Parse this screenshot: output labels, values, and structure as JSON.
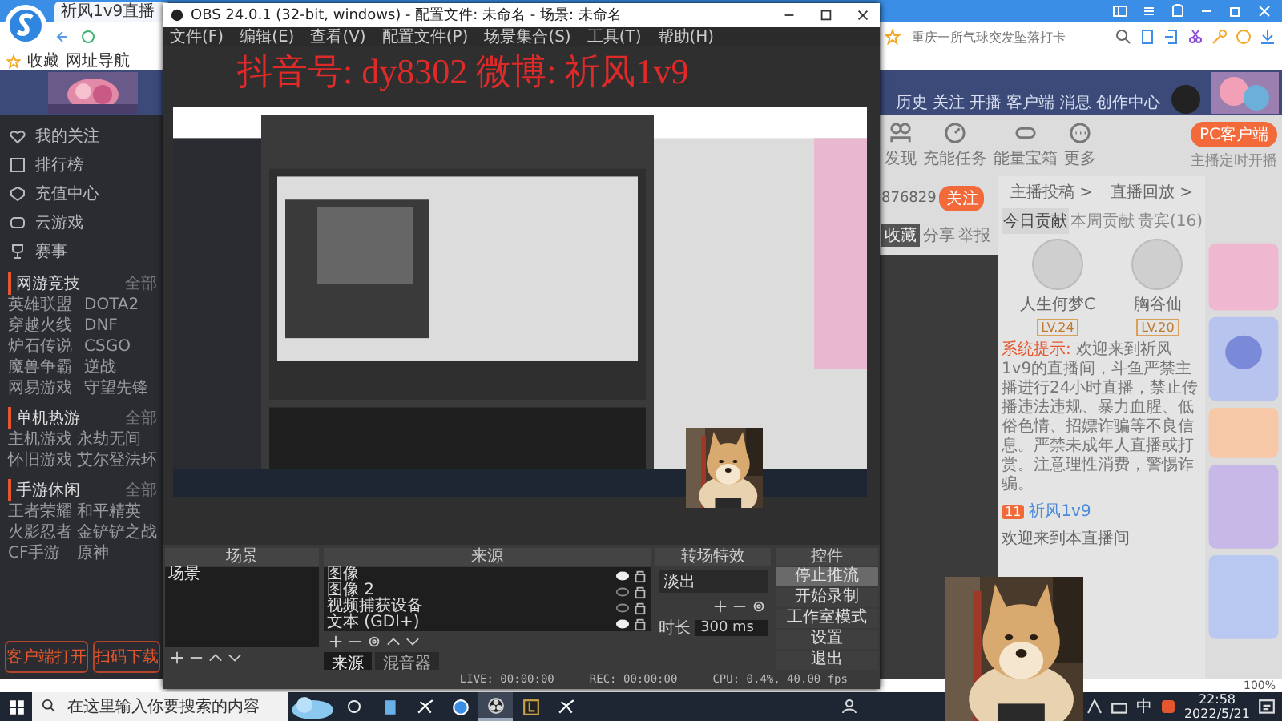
{
  "browser": {
    "tab_title": "祈风1v9直播",
    "bookmarks": [
      "收藏",
      "网址导航"
    ],
    "search": {
      "placeholder": "重庆一所气球突发坠落打卡"
    },
    "nav": [
      "历史",
      "关注",
      "开播",
      "客户端",
      "消息",
      "创作中心"
    ],
    "sidebar": {
      "items": [
        "我的关注",
        "排行榜",
        "充值中心",
        "云游戏",
        "赛事"
      ],
      "sections": [
        {
          "title": "网游竞技",
          "more": "全部",
          "links": [
            "英雄联盟",
            "DOTA2",
            "穿越火线",
            "DNF",
            "炉石传说",
            "CSGO",
            "魔兽争霸",
            "逆战",
            "网易游戏",
            "守望先锋"
          ]
        },
        {
          "title": "单机热游",
          "more": "全部",
          "links": [
            "主机游戏",
            "永劫无间",
            "怀旧游戏",
            "艾尔登法环"
          ]
        },
        {
          "title": "手游休闲",
          "more": "全部",
          "links": [
            "王者荣耀",
            "和平精英",
            "火影忍者",
            "金铲铲之战",
            "CF手游",
            "原神"
          ]
        }
      ],
      "buttons": [
        "客户端打开",
        "扫码下载"
      ]
    },
    "room": {
      "actions": [
        "发现",
        "充能任务",
        "能量宝箱",
        "更多"
      ],
      "client_button": "PC客户端",
      "client_note": "主播定时开播",
      "followers": "876829",
      "follow_button": "关注",
      "tools": [
        "收藏",
        "分享",
        "举报"
      ],
      "links": [
        "主播投稿 >",
        "直播回放 >"
      ],
      "rank_tabs": [
        {
          "label": "今日贡献",
          "selected": true
        },
        {
          "label": "本周贡献",
          "selected": false
        },
        {
          "label": "贵宾(16)",
          "selected": false
        }
      ],
      "users": [
        {
          "name": "人生何梦C",
          "level": "LV.24"
        },
        {
          "name": "胸谷仙",
          "level": "LV.20"
        }
      ],
      "system_label": "系统提示:",
      "system_message": "欢迎来到祈风1v9的直播间，斗鱼严禁主播进行24小时直播，禁止传播违法违规、暴力血腥、低俗色情、招嫖诈骗等不良信息。严禁未成年人直播或打赏。注意理性消费，警惕诈骗。",
      "chat": {
        "badge": "11",
        "user": "祈风1v9",
        "text": "欢迎来到本直播间"
      },
      "zoom": "100%"
    }
  },
  "overlay_text": "抖音号: dy8302  微博: 祈风1v9",
  "obs": {
    "title": "OBS 24.0.1 (32-bit, windows) - 配置文件: 未命名 - 场景: 未命名",
    "menu": [
      "文件(F)",
      "编辑(E)",
      "查看(V)",
      "配置文件(P)",
      "场景集合(S)",
      "工具(T)",
      "帮助(H)"
    ],
    "docks": {
      "scenes": {
        "title": "场景",
        "items": [
          "场景"
        ]
      },
      "sources": {
        "title": "来源",
        "items": [
          {
            "name": "图像",
            "visible": true
          },
          {
            "name": "图像 2",
            "visible": false
          },
          {
            "name": "视频捕获设备",
            "visible": false
          },
          {
            "name": "文本 (GDI+)",
            "visible": true
          }
        ]
      },
      "transitions": {
        "title": "转场特效",
        "value": "淡出",
        "duration_label": "时长",
        "duration": "300 ms"
      },
      "controls": {
        "title": "控件",
        "buttons": [
          {
            "label": "停止推流",
            "active": true
          },
          {
            "label": "开始录制",
            "active": false
          },
          {
            "label": "工作室模式",
            "active": false
          },
          {
            "label": "设置",
            "active": false
          },
          {
            "label": "退出",
            "active": false
          }
        ]
      }
    },
    "tabs": [
      {
        "label": "来源",
        "selected": true
      },
      {
        "label": "混音器",
        "selected": false
      }
    ],
    "status": [
      "LIVE: 00:00:00",
      "REC: 00:00:00",
      "CPU: 0.4%, 40.00 fps"
    ]
  },
  "taskbar": {
    "search": {
      "placeholder": "在这里输入你要搜索的内容"
    },
    "apps": [
      {
        "kind": "files",
        "selected": false
      },
      {
        "kind": "feather",
        "selected": false
      },
      {
        "kind": "browser",
        "selected": false
      },
      {
        "kind": "obs",
        "selected": true
      },
      {
        "kind": "letter",
        "selected": false
      },
      {
        "kind": "feather",
        "selected": false
      }
    ],
    "ime": "中",
    "time": "22:58",
    "date": "2022/5/21"
  }
}
